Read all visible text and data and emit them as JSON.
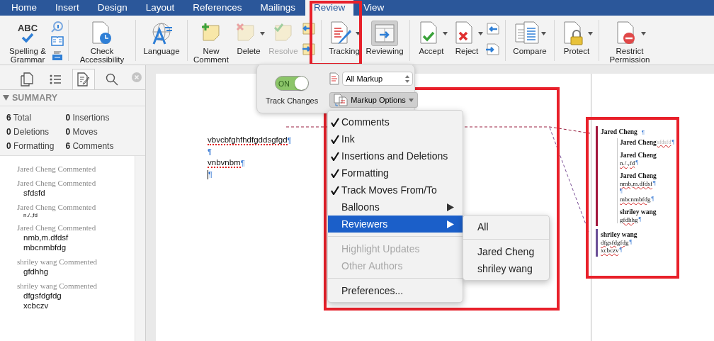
{
  "tabs": [
    {
      "label": "Home",
      "selected": false
    },
    {
      "label": "Insert",
      "selected": false
    },
    {
      "label": "Design",
      "selected": false
    },
    {
      "label": "Layout",
      "selected": false
    },
    {
      "label": "References",
      "selected": false
    },
    {
      "label": "Mailings",
      "selected": false
    },
    {
      "label": "Review",
      "selected": true
    },
    {
      "label": "View",
      "selected": false
    }
  ],
  "ribbon": {
    "groups": [
      {
        "items": [
          {
            "kind": "button",
            "label": "Spelling & Grammar",
            "icon_text": "ABC",
            "disabled": false,
            "pressed": false,
            "has_menu": false
          },
          {
            "kind": "icon-stack"
          }
        ]
      },
      {
        "items": [
          {
            "kind": "button",
            "label": "Check Accessibility",
            "disabled": false,
            "pressed": false,
            "has_menu": false
          }
        ]
      },
      {
        "items": [
          {
            "kind": "button",
            "label": "Language",
            "disabled": false,
            "pressed": false,
            "has_menu": false
          }
        ]
      },
      {
        "items": [
          {
            "kind": "button",
            "label": "New Comment",
            "disabled": false,
            "pressed": false,
            "has_menu": false
          },
          {
            "kind": "button",
            "label": "Delete",
            "disabled": false,
            "pressed": false,
            "has_menu": true
          },
          {
            "kind": "button",
            "label": "Resolve",
            "disabled": true,
            "pressed": false,
            "has_menu": false
          },
          {
            "kind": "icon-stack"
          }
        ]
      },
      {
        "items": [
          {
            "kind": "button",
            "label": "Tracking",
            "disabled": false,
            "pressed": false,
            "has_menu": true
          },
          {
            "kind": "button",
            "label": "Reviewing",
            "disabled": false,
            "pressed": true,
            "has_menu": false
          }
        ]
      },
      {
        "items": [
          {
            "kind": "button",
            "label": "Accept",
            "disabled": false,
            "pressed": false,
            "has_menu": true
          },
          {
            "kind": "button",
            "label": "Reject",
            "disabled": false,
            "pressed": false,
            "has_menu": true
          },
          {
            "kind": "icon-stack"
          }
        ]
      },
      {
        "items": [
          {
            "kind": "button",
            "label": "Compare",
            "disabled": false,
            "pressed": false,
            "has_menu": true
          }
        ]
      },
      {
        "items": [
          {
            "kind": "button",
            "label": "Protect",
            "disabled": false,
            "pressed": false,
            "has_menu": true
          }
        ]
      },
      {
        "items": [
          {
            "kind": "button",
            "label": "Restrict Permission",
            "disabled": false,
            "pressed": false,
            "has_menu": true
          }
        ]
      }
    ]
  },
  "pane": {
    "tabs": [
      {
        "selected": false
      },
      {
        "selected": false
      },
      {
        "selected": true
      },
      {
        "selected": false
      }
    ],
    "summary": {
      "title": "SUMMARY",
      "expanded": true,
      "counts": [
        "**6** Total",
        "**0** Insertions",
        "**0** Deletions",
        "**0** Moves",
        "**0** Formatting",
        "**6** Comments"
      ]
    },
    "comments": [
      {
        "heading": "Jared Cheng Commented"
      },
      {
        "heading": "Jared Cheng Commented",
        "small_text": false,
        "lines": [
          "sfdsfd"
        ]
      },
      {
        "heading": "Jared Cheng Commented",
        "small_text": true,
        "lines": [
          "n./.,fd"
        ]
      },
      {
        "heading": "Jared Cheng Commented",
        "small_text": false,
        "lines": [
          "nmb,m.dfdsf",
          "mbcnmbfdg"
        ]
      },
      {
        "heading": "shriley wang Commented",
        "small_text": false,
        "lines": [
          "gfdhhg"
        ]
      },
      {
        "heading": "shriley wang Commented",
        "small_text": false,
        "lines": [
          "dfgsfdgfdg",
          "xcbczv"
        ]
      }
    ]
  },
  "document": {
    "paragraphs": [
      {
        "text": "vbvcbfghfhdfgddsgfgd",
        "mark": "¶",
        "misspelled": true,
        "cursor": false
      },
      {
        "mark": "¶",
        "misspelled": false,
        "cursor": false
      },
      {
        "text": "vnbvnbm",
        "mark": "¶",
        "misspelled": true,
        "cursor": false
      },
      {
        "mark": "¶",
        "misspelled": false,
        "cursor": true
      }
    ]
  },
  "tracking_popover": {
    "toggle": {
      "label": "Track Changes",
      "state_label": "ON",
      "on": true
    },
    "markup_select": {
      "value": "All Markup"
    },
    "markup_options": {
      "label": "Markup Options"
    }
  },
  "markup_menu": {
    "items": [
      {
        "kind": "check",
        "label": "Comments",
        "checked": true,
        "selected": false,
        "disabled": false
      },
      {
        "kind": "check",
        "label": "Ink",
        "checked": true,
        "selected": false,
        "disabled": false
      },
      {
        "kind": "check",
        "label": "Insertions and Deletions",
        "checked": true,
        "selected": false,
        "disabled": false
      },
      {
        "kind": "check",
        "label": "Formatting",
        "checked": true,
        "selected": false,
        "disabled": false
      },
      {
        "kind": "check",
        "label": "Track Moves From/To",
        "checked": true,
        "selected": false,
        "disabled": false
      },
      {
        "kind": "submenu",
        "label": "Balloons",
        "selected": false,
        "disabled": false
      },
      {
        "kind": "submenu",
        "label": "Reviewers",
        "selected": true,
        "disabled": false
      },
      {
        "kind": "separator"
      },
      {
        "kind": "plain",
        "label": "Highlight Updates",
        "selected": false,
        "disabled": true
      },
      {
        "kind": "plain",
        "label": "Other Authors",
        "selected": false,
        "disabled": true
      },
      {
        "kind": "separator"
      },
      {
        "kind": "plain",
        "label": "Preferences...",
        "selected": false,
        "disabled": false
      }
    ]
  },
  "reviewers_menu": {
    "items": [
      {
        "kind": "plain",
        "label": "All"
      },
      {
        "kind": "separator"
      },
      {
        "kind": "plain",
        "label": "Jared Cheng"
      },
      {
        "kind": "plain",
        "label": "shriley wang"
      }
    ]
  },
  "balloons": [
    {
      "author": "Jared Cheng",
      "mark": "¶",
      "color": "#a3173d",
      "children": [
        {
          "author": "Jared Cheng",
          "lines": [
            {
              "text": "sfdsfd",
              "mark": "¶",
              "faint": true
            }
          ]
        },
        {
          "author": "Jared Cheng",
          "lines": [
            {
              "text": "n./.,fd",
              "mark": "¶",
              "faint": false
            }
          ]
        },
        {
          "author": "Jared Cheng",
          "lines": [
            {
              "text": "nmb,m.dfdsf",
              "mark": "¶",
              "faint": false
            },
            {
              "mark": "¶",
              "faint": false
            },
            {
              "text": "mbcnmbfdg",
              "mark": "¶",
              "faint": false
            }
          ]
        },
        {
          "author": "shriley wang",
          "lines": [
            {
              "text": "gfdhhg",
              "mark": "¶",
              "faint": false
            }
          ]
        }
      ]
    },
    {
      "author": "shriley wang",
      "color": "#6b4f96",
      "lines": [
        {
          "text": "dfgsfdgfdg",
          "mark": "¶",
          "faint": false
        },
        {
          "text": "xcbczv",
          "mark": "¶",
          "faint": false
        }
      ]
    }
  ]
}
